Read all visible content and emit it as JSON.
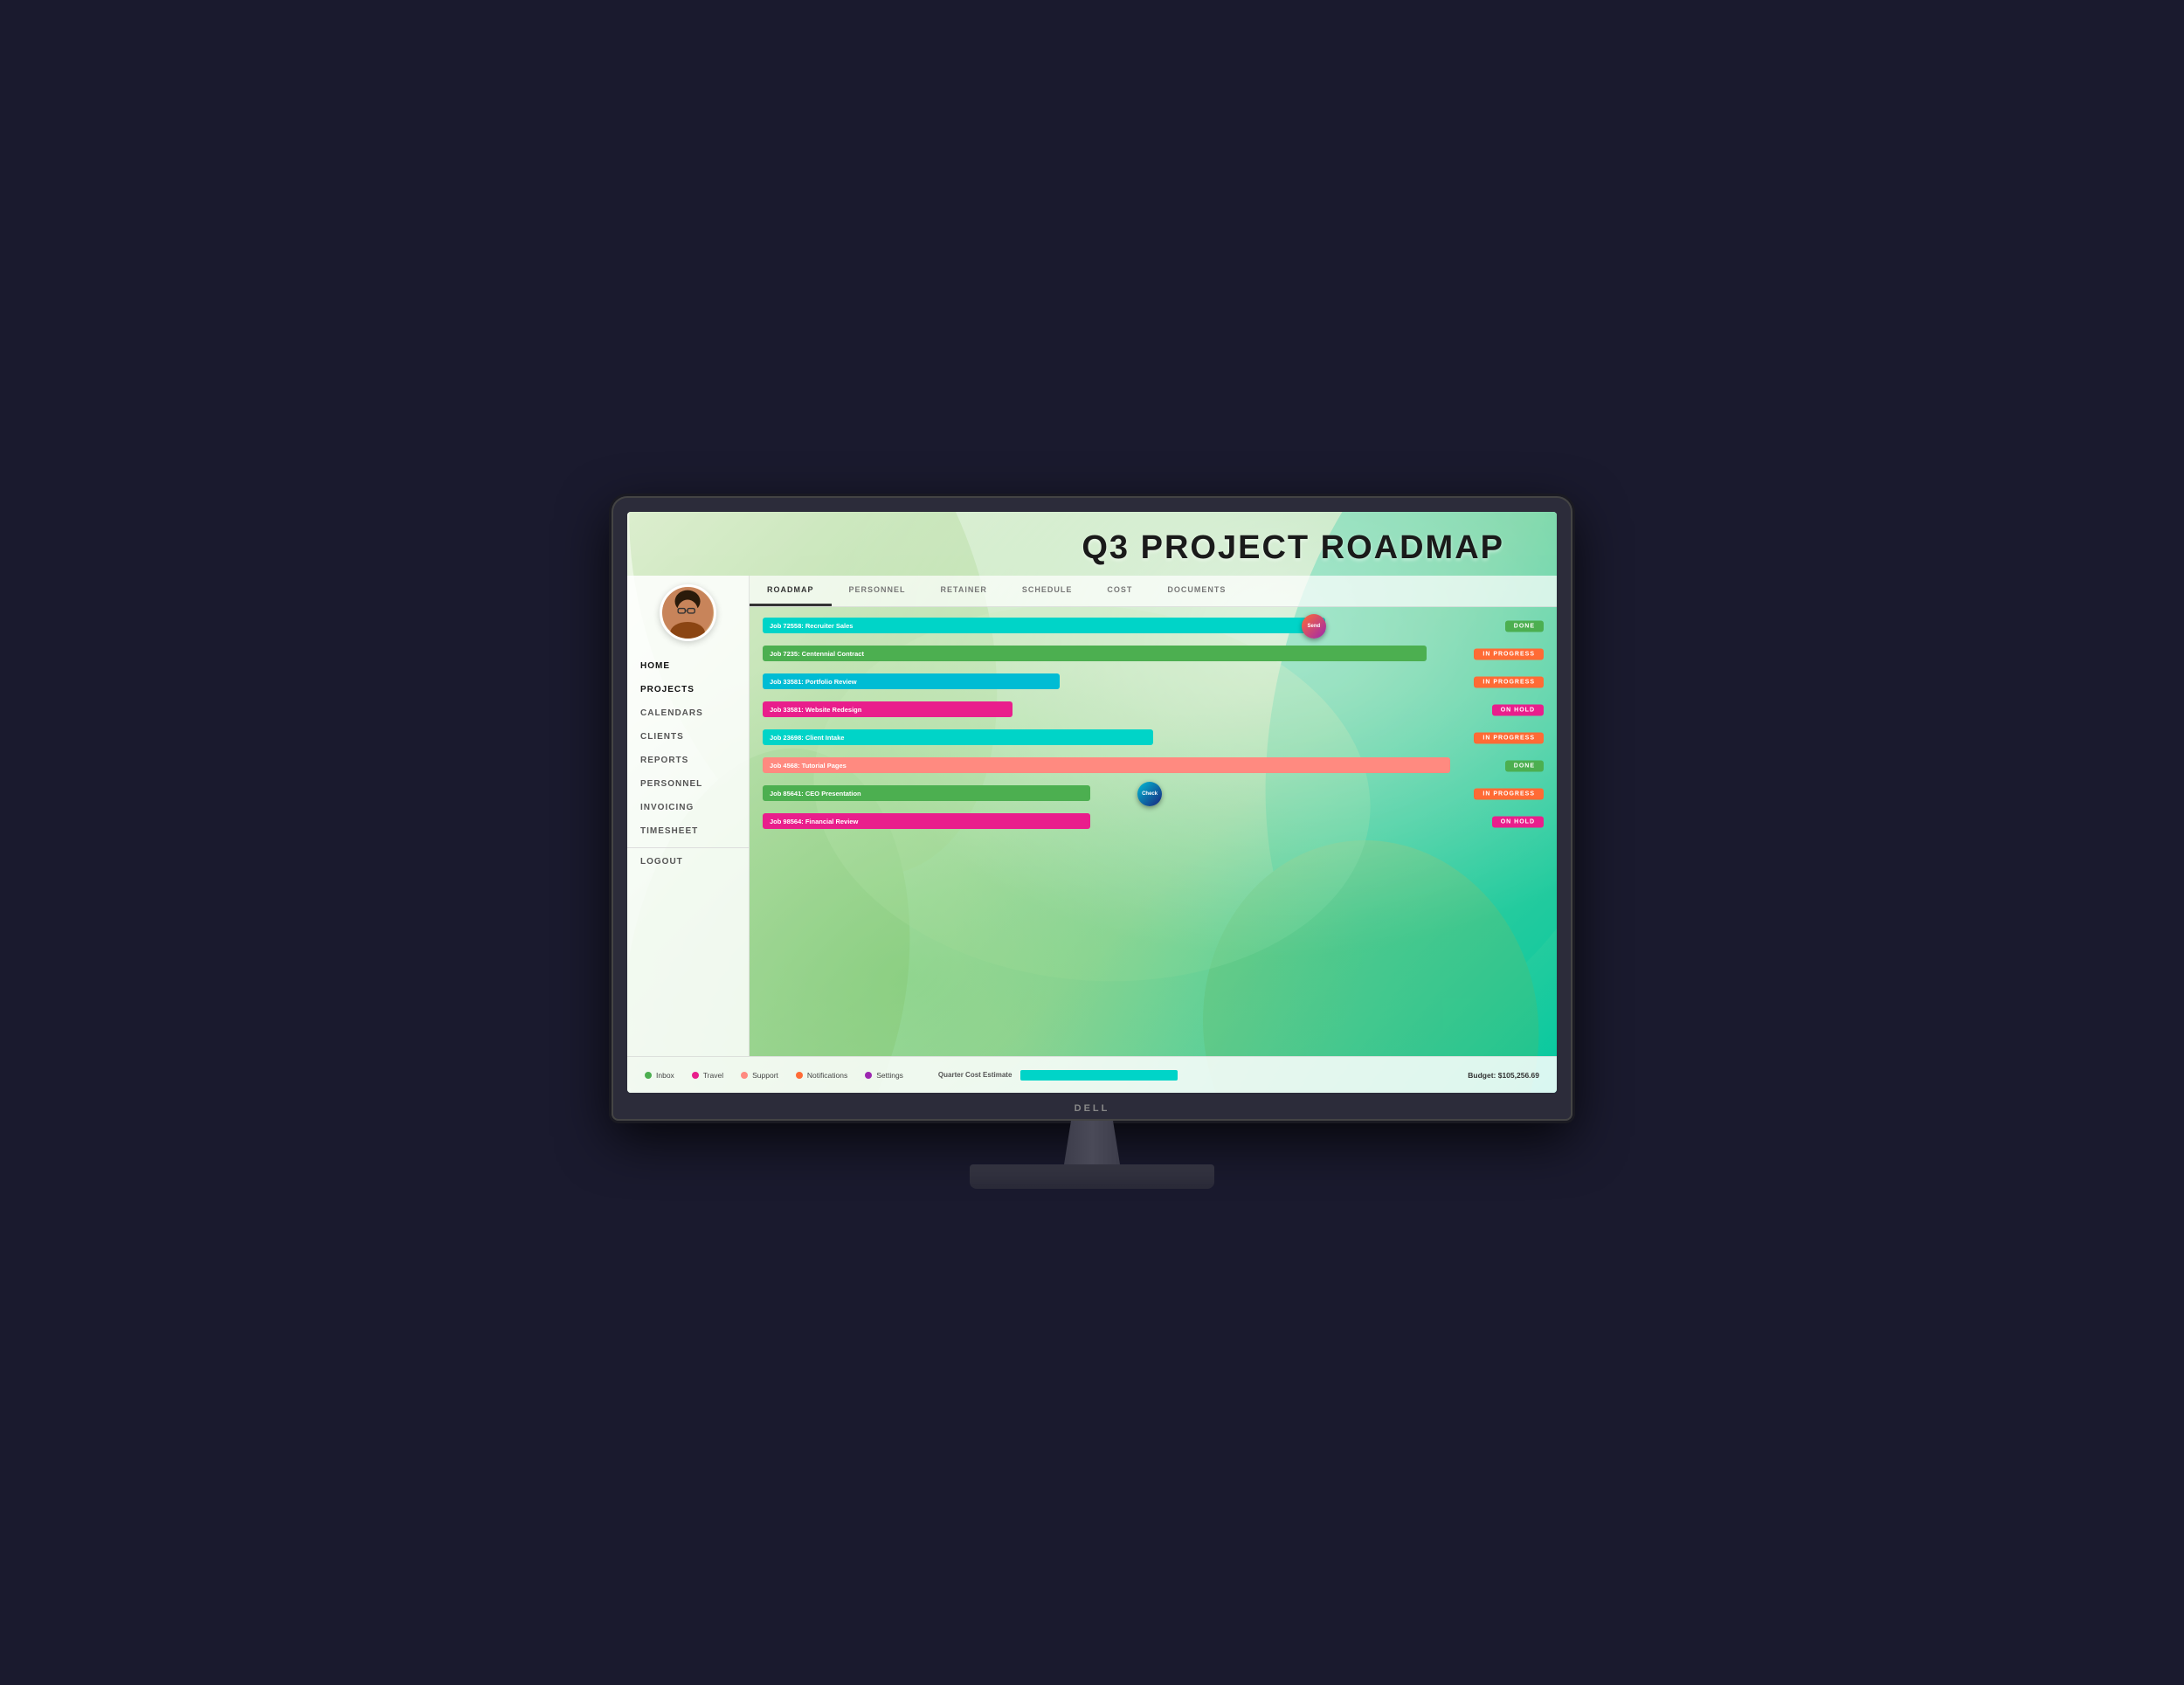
{
  "monitor": {
    "brand": "DELL"
  },
  "page": {
    "title": "Q3 PROJECT ROADMAP"
  },
  "tabs": [
    {
      "label": "ROADMAP",
      "active": true
    },
    {
      "label": "PERSONNEL",
      "active": false
    },
    {
      "label": "RETAINER",
      "active": false
    },
    {
      "label": "SCHEDULE",
      "active": false
    },
    {
      "label": "COST",
      "active": false
    },
    {
      "label": "DOCUMENTS",
      "active": false
    }
  ],
  "nav": [
    {
      "label": "HOME",
      "active": false
    },
    {
      "label": "PROJECTS",
      "active": true
    },
    {
      "label": "CALENDARS",
      "active": false
    },
    {
      "label": "CLIENTS",
      "active": false
    },
    {
      "label": "REPORTS",
      "active": false
    },
    {
      "label": "PERSONNEL",
      "active": false
    },
    {
      "label": "INVOICING",
      "active": false
    },
    {
      "label": "TIMESHEET",
      "active": false
    },
    {
      "label": "LOGOUT",
      "active": false,
      "separator": true
    }
  ],
  "gantt_rows": [
    {
      "label": "Job 72558: Recruiter Sales",
      "bar_color": "#00d4c8",
      "bar_left": "0%",
      "bar_width": "72%",
      "status": "DONE",
      "status_type": "done",
      "has_marker": true,
      "marker_label": "Send",
      "marker_left": "69%",
      "marker_color": "linear-gradient(135deg, #ff6b35, #9c27b0)"
    },
    {
      "label": "Job 7235: Centennial Contract",
      "bar_color": "#4caf50",
      "bar_left": "0%",
      "bar_width": "85%",
      "status": "IN PROGRESS",
      "status_type": "progress",
      "has_marker": false
    },
    {
      "label": "Job 33581: Portfolio Review",
      "bar_color": "#00bcd4",
      "bar_left": "0%",
      "bar_width": "38%",
      "status": "IN PROGRESS",
      "status_type": "progress",
      "has_marker": false
    },
    {
      "label": "Job 33581: Website Redesign",
      "bar_color": "#e91e8c",
      "bar_left": "0%",
      "bar_width": "32%",
      "status": "ON HOLD",
      "status_type": "hold",
      "has_marker": false
    },
    {
      "label": "Job 23698: Client Intake",
      "bar_color": "#00d4c8",
      "bar_left": "0%",
      "bar_width": "50%",
      "status": "IN PROGRESS",
      "status_type": "progress",
      "has_marker": false
    },
    {
      "label": "Job 4568: Tutorial Pages",
      "bar_color": "#ff8a80",
      "bar_left": "0%",
      "bar_width": "88%",
      "status": "DONE",
      "status_type": "done",
      "has_marker": false
    },
    {
      "label": "Job 85641: CEO Presentation",
      "bar_color": "#4caf50",
      "bar_left": "0%",
      "bar_width": "42%",
      "status": "IN PROGRESS",
      "status_type": "progress",
      "has_marker": true,
      "marker_label": "Check",
      "marker_left": "48%",
      "marker_color": "linear-gradient(135deg, #00bcd4, #1a237e)"
    },
    {
      "label": "Job 98564: Financial Review",
      "bar_color": "#e91e8c",
      "bar_left": "0%",
      "bar_width": "42%",
      "status": "ON HOLD",
      "status_type": "hold",
      "has_marker": false
    }
  ],
  "legend": [
    {
      "label": "Inbox",
      "color": "#4caf50"
    },
    {
      "label": "Travel",
      "color": "#e91e8c"
    },
    {
      "label": "Support",
      "color": "#ff8a80"
    },
    {
      "label": "Notifications",
      "color": "#ff6b35"
    },
    {
      "label": "Settings",
      "color": "#9c27b0"
    }
  ],
  "bottom": {
    "quarter_label": "Quarter Cost Estimate",
    "budget": "Budget: $105,256.69"
  }
}
